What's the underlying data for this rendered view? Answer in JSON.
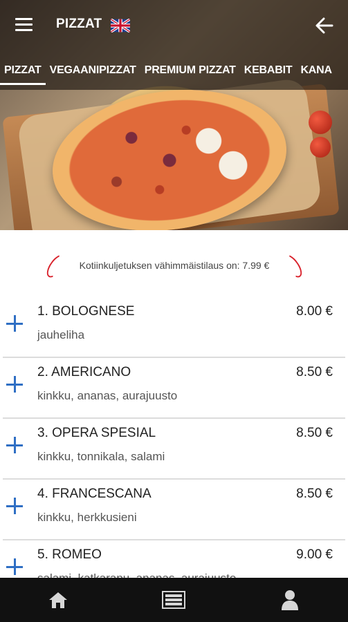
{
  "header": {
    "title": "PIZZAT",
    "language_icon": "uk-flag-icon",
    "menu_icon": "hamburger-menu-icon",
    "back_icon": "arrow-left-icon"
  },
  "tabs": [
    {
      "label": "PIZZAT",
      "active": true
    },
    {
      "label": "VEGAANIPIZZAT",
      "active": false
    },
    {
      "label": "PREMIUM PIZZAT",
      "active": false
    },
    {
      "label": "KEBABIT",
      "active": false
    },
    {
      "label": "KANA",
      "active": false
    }
  ],
  "notice": {
    "min_order": "Kotiinkuljetuksen vähimmäistilaus on: 7.99 €"
  },
  "menu_items": [
    {
      "name": "1. BOLOGNESE",
      "desc": "jauheliha",
      "price": "8.00 €"
    },
    {
      "name": "2. AMERICANO",
      "desc": "kinkku, ananas, aurajuusto",
      "price": "8.50 €"
    },
    {
      "name": "3. OPERA SPESIAL",
      "desc": "kinkku, tonnikala, salami",
      "price": "8.50 €"
    },
    {
      "name": "4. FRANCESCANA",
      "desc": "kinkku, herkkusieni",
      "price": "8.50 €"
    },
    {
      "name": "5. ROMEO",
      "desc": "salami, katkarapu, ananas, aurajuusto",
      "price": "9.00 €"
    }
  ],
  "bottom_nav": {
    "items": [
      "home-icon",
      "menu-list-icon",
      "user-icon"
    ]
  },
  "colors": {
    "accent_blue": "#2f6fc4",
    "accent_red": "#d9232d",
    "nav_bg": "#111111"
  }
}
